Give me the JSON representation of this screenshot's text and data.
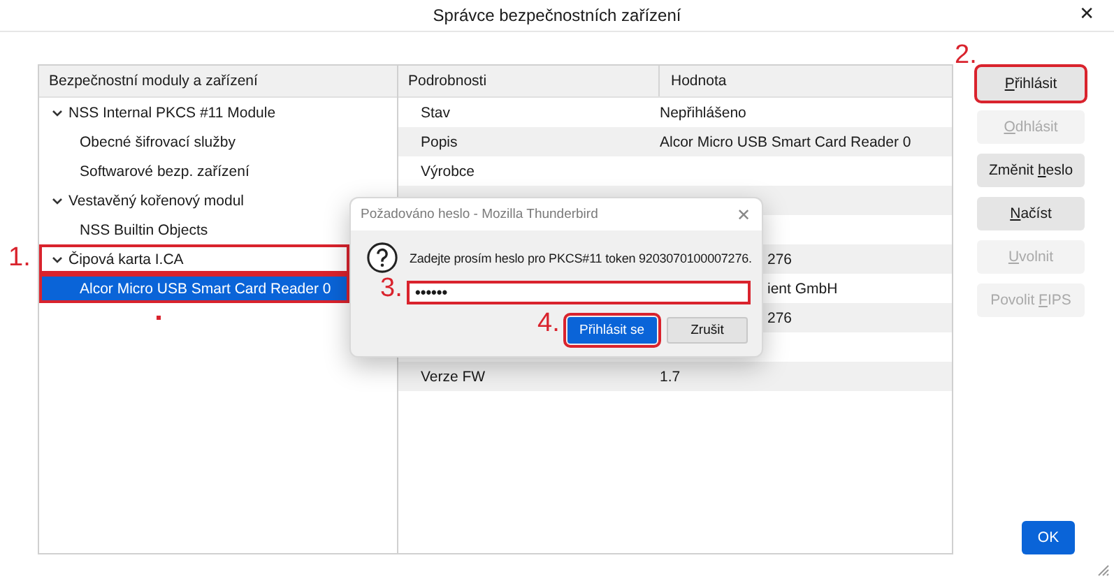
{
  "window": {
    "title": "Správce bezpečnostních zařízení",
    "close": "✕"
  },
  "tree": {
    "header": "Bezpečnostní moduly a zařízení",
    "items": [
      {
        "label": "NSS Internal PKCS #11 Module",
        "expanded": true,
        "selected": false,
        "children": [
          {
            "label": "Obecné šifrovací služby",
            "selected": false
          },
          {
            "label": "Softwarové bezp. zařízení",
            "selected": false
          }
        ]
      },
      {
        "label": "Vestavěný kořenový modul",
        "expanded": true,
        "selected": false,
        "children": [
          {
            "label": "NSS Builtin Objects",
            "selected": false
          }
        ]
      },
      {
        "label": "Čipová karta I.CA",
        "expanded": true,
        "selected": false,
        "highlighted": true,
        "marker": "1.",
        "children": [
          {
            "label": "Alcor Micro USB Smart Card Reader 0",
            "selected": true,
            "highlighted": true,
            "dot": true
          }
        ]
      }
    ]
  },
  "details": {
    "columns": [
      "Podrobnosti",
      "Hodnota"
    ],
    "rows": [
      {
        "kind": "full",
        "name": "Stav",
        "value": "Nepřihlášeno"
      },
      {
        "kind": "full",
        "name": "Popis",
        "value": "Alcor Micro USB Smart Card Reader 0"
      },
      {
        "kind": "full",
        "name": "Výrobce"
      },
      {
        "kind": "hidden"
      },
      {
        "kind": "hidden"
      },
      {
        "kind": "partial",
        "value": "276"
      },
      {
        "kind": "partial",
        "value": "ient GmbH"
      },
      {
        "kind": "partial",
        "value": "276"
      },
      {
        "kind": "hidden"
      },
      {
        "kind": "full",
        "name": "Verze FW",
        "value": "1.7"
      }
    ]
  },
  "buttons": [
    {
      "label": {
        "key": "P",
        "after": "řihlásit"
      },
      "disabled": false,
      "highlighted": true,
      "marker": "2."
    },
    {
      "label": {
        "key": "O",
        "after": "dhlásit"
      },
      "disabled": true,
      "highlighted": false
    },
    {
      "label": {
        "before": "Změnit ",
        "key": "h",
        "after": "eslo"
      },
      "disabled": false,
      "highlighted": false
    },
    {
      "label": {
        "key": "N",
        "after": "ačíst"
      },
      "disabled": false,
      "highlighted": false
    },
    {
      "label": {
        "key": "U",
        "after": "volnit"
      },
      "disabled": true,
      "highlighted": false
    },
    {
      "label": {
        "before": "Povolit ",
        "key": "F",
        "after": "IPS"
      },
      "disabled": true,
      "highlighted": false
    }
  ],
  "ok_button": "OK",
  "dialog": {
    "title": "Požadováno heslo - Mozilla Thunderbird",
    "close": "✕",
    "message": "Zadejte prosím heslo pro PKCS#11 token 9203070100007276.",
    "password": {
      "value": "••••••",
      "highlighted": true,
      "marker": "3."
    },
    "buttons": [
      {
        "label": "Přihlásit se",
        "kind": "primary",
        "highlighted": true,
        "marker": "4."
      },
      {
        "label": "Zrušit",
        "kind": "secondary",
        "highlighted": false
      }
    ]
  }
}
